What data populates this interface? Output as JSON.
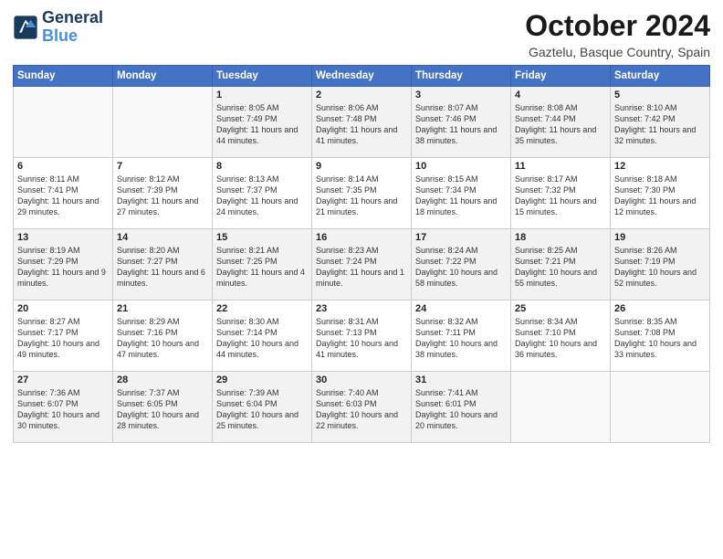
{
  "header": {
    "logo_line1": "General",
    "logo_line2": "Blue",
    "month": "October 2024",
    "location": "Gaztelu, Basque Country, Spain"
  },
  "days_of_week": [
    "Sunday",
    "Monday",
    "Tuesday",
    "Wednesday",
    "Thursday",
    "Friday",
    "Saturday"
  ],
  "weeks": [
    [
      {
        "day": "",
        "content": ""
      },
      {
        "day": "",
        "content": ""
      },
      {
        "day": "1",
        "content": "Sunrise: 8:05 AM\nSunset: 7:49 PM\nDaylight: 11 hours\nand 44 minutes."
      },
      {
        "day": "2",
        "content": "Sunrise: 8:06 AM\nSunset: 7:48 PM\nDaylight: 11 hours\nand 41 minutes."
      },
      {
        "day": "3",
        "content": "Sunrise: 8:07 AM\nSunset: 7:46 PM\nDaylight: 11 hours\nand 38 minutes."
      },
      {
        "day": "4",
        "content": "Sunrise: 8:08 AM\nSunset: 7:44 PM\nDaylight: 11 hours\nand 35 minutes."
      },
      {
        "day": "5",
        "content": "Sunrise: 8:10 AM\nSunset: 7:42 PM\nDaylight: 11 hours\nand 32 minutes."
      }
    ],
    [
      {
        "day": "6",
        "content": "Sunrise: 8:11 AM\nSunset: 7:41 PM\nDaylight: 11 hours\nand 29 minutes."
      },
      {
        "day": "7",
        "content": "Sunrise: 8:12 AM\nSunset: 7:39 PM\nDaylight: 11 hours\nand 27 minutes."
      },
      {
        "day": "8",
        "content": "Sunrise: 8:13 AM\nSunset: 7:37 PM\nDaylight: 11 hours\nand 24 minutes."
      },
      {
        "day": "9",
        "content": "Sunrise: 8:14 AM\nSunset: 7:35 PM\nDaylight: 11 hours\nand 21 minutes."
      },
      {
        "day": "10",
        "content": "Sunrise: 8:15 AM\nSunset: 7:34 PM\nDaylight: 11 hours\nand 18 minutes."
      },
      {
        "day": "11",
        "content": "Sunrise: 8:17 AM\nSunset: 7:32 PM\nDaylight: 11 hours\nand 15 minutes."
      },
      {
        "day": "12",
        "content": "Sunrise: 8:18 AM\nSunset: 7:30 PM\nDaylight: 11 hours\nand 12 minutes."
      }
    ],
    [
      {
        "day": "13",
        "content": "Sunrise: 8:19 AM\nSunset: 7:29 PM\nDaylight: 11 hours\nand 9 minutes."
      },
      {
        "day": "14",
        "content": "Sunrise: 8:20 AM\nSunset: 7:27 PM\nDaylight: 11 hours\nand 6 minutes."
      },
      {
        "day": "15",
        "content": "Sunrise: 8:21 AM\nSunset: 7:25 PM\nDaylight: 11 hours\nand 4 minutes."
      },
      {
        "day": "16",
        "content": "Sunrise: 8:23 AM\nSunset: 7:24 PM\nDaylight: 11 hours\nand 1 minute."
      },
      {
        "day": "17",
        "content": "Sunrise: 8:24 AM\nSunset: 7:22 PM\nDaylight: 10 hours\nand 58 minutes."
      },
      {
        "day": "18",
        "content": "Sunrise: 8:25 AM\nSunset: 7:21 PM\nDaylight: 10 hours\nand 55 minutes."
      },
      {
        "day": "19",
        "content": "Sunrise: 8:26 AM\nSunset: 7:19 PM\nDaylight: 10 hours\nand 52 minutes."
      }
    ],
    [
      {
        "day": "20",
        "content": "Sunrise: 8:27 AM\nSunset: 7:17 PM\nDaylight: 10 hours\nand 49 minutes."
      },
      {
        "day": "21",
        "content": "Sunrise: 8:29 AM\nSunset: 7:16 PM\nDaylight: 10 hours\nand 47 minutes."
      },
      {
        "day": "22",
        "content": "Sunrise: 8:30 AM\nSunset: 7:14 PM\nDaylight: 10 hours\nand 44 minutes."
      },
      {
        "day": "23",
        "content": "Sunrise: 8:31 AM\nSunset: 7:13 PM\nDaylight: 10 hours\nand 41 minutes."
      },
      {
        "day": "24",
        "content": "Sunrise: 8:32 AM\nSunset: 7:11 PM\nDaylight: 10 hours\nand 38 minutes."
      },
      {
        "day": "25",
        "content": "Sunrise: 8:34 AM\nSunset: 7:10 PM\nDaylight: 10 hours\nand 36 minutes."
      },
      {
        "day": "26",
        "content": "Sunrise: 8:35 AM\nSunset: 7:08 PM\nDaylight: 10 hours\nand 33 minutes."
      }
    ],
    [
      {
        "day": "27",
        "content": "Sunrise: 7:36 AM\nSunset: 6:07 PM\nDaylight: 10 hours\nand 30 minutes."
      },
      {
        "day": "28",
        "content": "Sunrise: 7:37 AM\nSunset: 6:05 PM\nDaylight: 10 hours\nand 28 minutes."
      },
      {
        "day": "29",
        "content": "Sunrise: 7:39 AM\nSunset: 6:04 PM\nDaylight: 10 hours\nand 25 minutes."
      },
      {
        "day": "30",
        "content": "Sunrise: 7:40 AM\nSunset: 6:03 PM\nDaylight: 10 hours\nand 22 minutes."
      },
      {
        "day": "31",
        "content": "Sunrise: 7:41 AM\nSunset: 6:01 PM\nDaylight: 10 hours\nand 20 minutes."
      },
      {
        "day": "",
        "content": ""
      },
      {
        "day": "",
        "content": ""
      }
    ]
  ]
}
